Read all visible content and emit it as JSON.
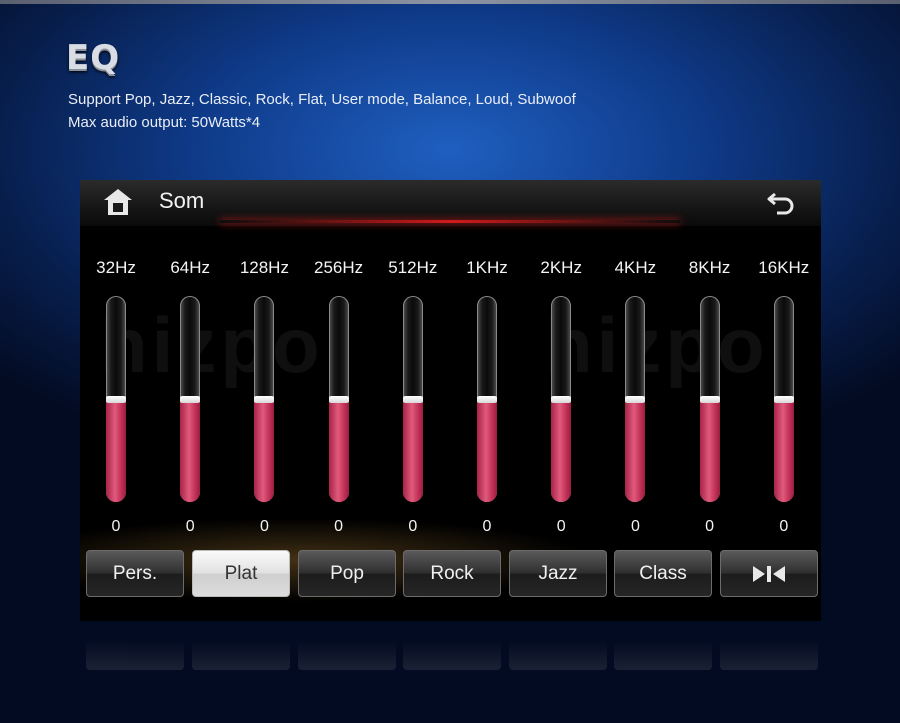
{
  "header": {
    "logo": "EQ",
    "line1": "Support Pop, Jazz, Classic, Rock, Flat, User mode, Balance, Loud, Subwoof",
    "line2": "Max audio output: 50Watts*4"
  },
  "screen": {
    "title": "Som",
    "home_icon": "home-icon",
    "back_icon": "back-arrow-icon",
    "watermark": [
      "hizpo",
      "hizpo"
    ],
    "accent_color": "#d11a1a",
    "fill_color": "#d8456a"
  },
  "bands": [
    {
      "label": "32Hz",
      "value": "0",
      "level": 0.5
    },
    {
      "label": "64Hz",
      "value": "0",
      "level": 0.5
    },
    {
      "label": "128Hz",
      "value": "0",
      "level": 0.5
    },
    {
      "label": "256Hz",
      "value": "0",
      "level": 0.5
    },
    {
      "label": "512Hz",
      "value": "0",
      "level": 0.5
    },
    {
      "label": "1KHz",
      "value": "0",
      "level": 0.5
    },
    {
      "label": "2KHz",
      "value": "0",
      "level": 0.5
    },
    {
      "label": "4KHz",
      "value": "0",
      "level": 0.5
    },
    {
      "label": "8KHz",
      "value": "0",
      "level": 0.5
    },
    {
      "label": "16KHz",
      "value": "0",
      "level": 0.5
    }
  ],
  "presets": [
    {
      "label": "Pers.",
      "active": false
    },
    {
      "label": "Plat",
      "active": true
    },
    {
      "label": "Pop",
      "active": false
    },
    {
      "label": "Rock",
      "active": false
    },
    {
      "label": "Jazz",
      "active": false
    },
    {
      "label": "Class",
      "active": false
    },
    {
      "label": "",
      "icon": "balance-icon",
      "active": false
    }
  ]
}
